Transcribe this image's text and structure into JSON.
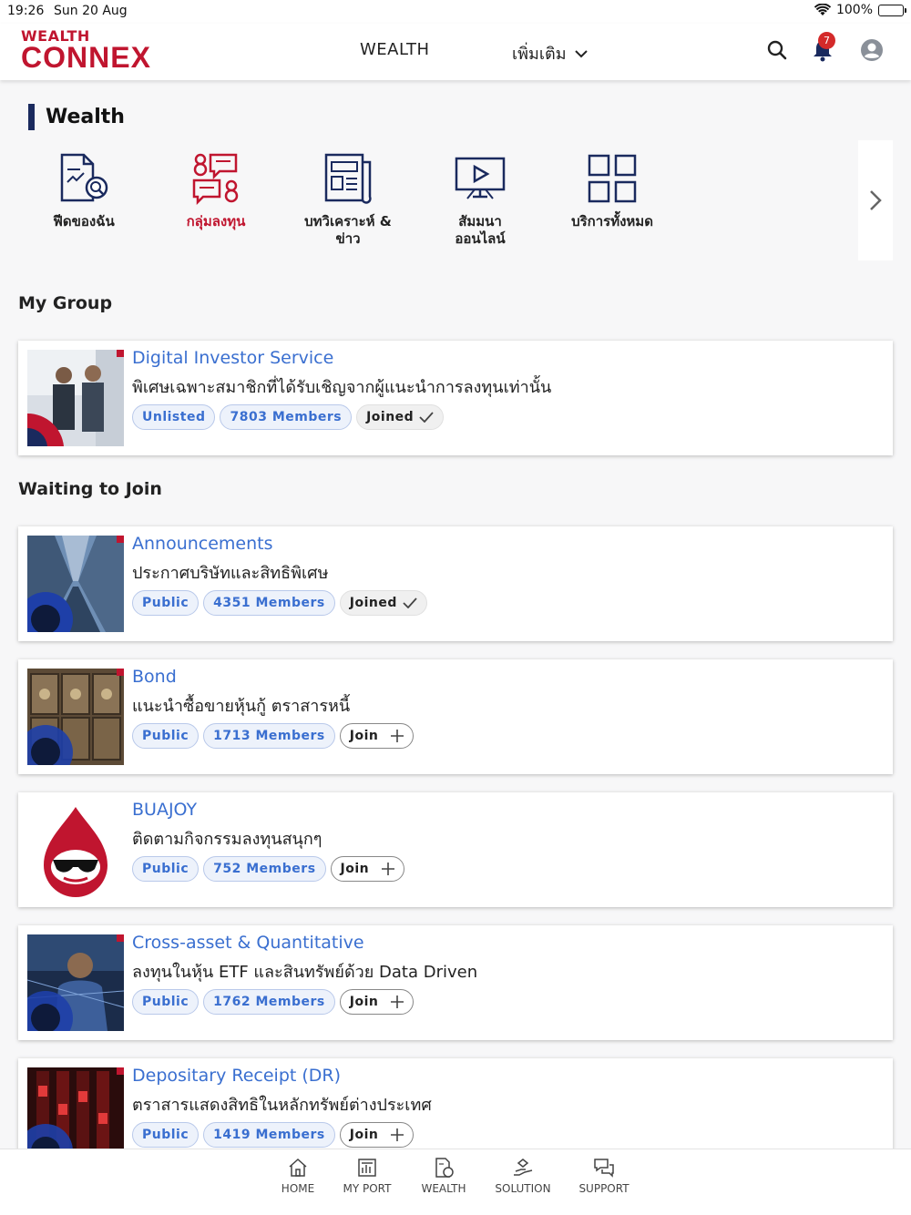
{
  "status_bar": {
    "time": "19:26",
    "date": "Sun 20 Aug",
    "battery": "100%"
  },
  "header": {
    "logo_top": "WEALTH",
    "logo_bottom": "CONNEX",
    "nav_wealth": "WEALTH",
    "nav_more": "เพิ่มเติม",
    "notification_count": "7"
  },
  "section_title": "Wealth",
  "menu": [
    {
      "label": "ฟีดของฉัน",
      "icon": "feed-document-icon"
    },
    {
      "label": "กลุ่มลงทุน",
      "icon": "investment-group-icon"
    },
    {
      "label_line1": "บทวิเคราะห์ &",
      "label_line2": "ข่าว",
      "icon": "news-icon"
    },
    {
      "label_line1": "สัมมนา",
      "label_line2": "ออนไลน์",
      "icon": "online-seminar-icon"
    },
    {
      "label": "บริการทั้งหมด",
      "icon": "all-services-icon"
    }
  ],
  "my_group_title": "My Group",
  "waiting_title": "Waiting to Join",
  "groups": [
    {
      "name": "Digital Investor Service",
      "desc": "พิเศษเฉพาะสมาชิกที่ได้รับเชิญจากผู้แนะนำการลงทุนเท่านั้น",
      "type": "Unlisted",
      "members": "7803 Members",
      "action": "Joined"
    },
    {
      "name": "Announcements",
      "desc": "ประกาศบริษัทและสิทธิพิเศษ",
      "type": "Public",
      "members": "4351 Members",
      "action": "Joined"
    },
    {
      "name": "Bond",
      "desc": "แนะนำซื้อขายหุ้นกู้ ตราสารหนี้",
      "type": "Public",
      "members": "1713 Members",
      "action": "Join"
    },
    {
      "name": "BUAJOY",
      "desc": "ติดตามกิจกรรมลงทุนสนุกๆ",
      "type": "Public",
      "members": "752 Members",
      "action": "Join"
    },
    {
      "name": "Cross-asset & Quantitative",
      "desc": "ลงทุนในหุ้น ETF และสินทรัพย์ด้วย Data Driven",
      "type": "Public",
      "members": "1762 Members",
      "action": "Join"
    },
    {
      "name": "Depositary Receipt (DR)",
      "desc": "ตราสารแสดงสิทธิในหลักทรัพย์ต่างประเทศ",
      "type": "Public",
      "members": "1419 Members",
      "action": "Join"
    }
  ],
  "bottom_nav": [
    {
      "label": "HOME",
      "icon": "home-icon"
    },
    {
      "label": "MY PORT",
      "icon": "my-port-icon"
    },
    {
      "label": "WEALTH",
      "icon": "wealth-icon"
    },
    {
      "label": "SOLUTION",
      "icon": "solution-icon"
    },
    {
      "label": "SUPPORT",
      "icon": "support-icon"
    }
  ],
  "colors": {
    "brand": "#c0152f",
    "accent": "#3a6fd0",
    "navy": "#1a2a5e"
  }
}
